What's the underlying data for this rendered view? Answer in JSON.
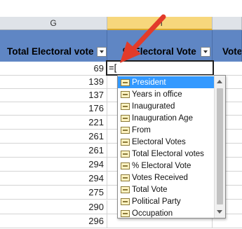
{
  "sheet": {
    "column_headers": [
      "G",
      "H"
    ],
    "table_headers": [
      "Total Electoral vote",
      "% Electoral Vote",
      "Vote"
    ],
    "column_g_values": [
      "69",
      "139",
      "137",
      "176",
      "221",
      "261",
      "261",
      "294",
      "294",
      "275",
      "290",
      "296"
    ],
    "active_cell_formula": "=["
  },
  "autocomplete": {
    "items": [
      "President",
      "Years in office",
      "Inaugurated",
      "Inauguration Age",
      "From",
      "Electoral Votes",
      "Total Electoral votes",
      "% Electoral Vote",
      "Votes Received",
      "Total Vote",
      "Political Party",
      "Occupation"
    ],
    "selected_index": 0
  },
  "colors": {
    "header_blue": "#5f86c4",
    "selected_column": "#f7d77c",
    "highlight": "#3399ff",
    "annotation_arrow": "#e23b2a"
  },
  "icons": {
    "filter": "chevron-down-icon",
    "field": "field-icon",
    "annotation": "red-arrow-icon"
  }
}
